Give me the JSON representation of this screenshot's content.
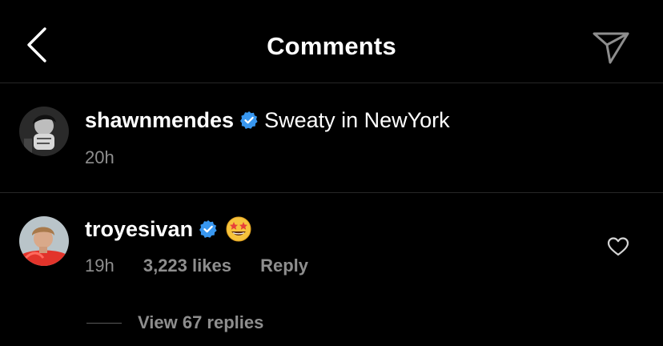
{
  "header": {
    "back_icon": "chevron-left-icon",
    "title": "Comments",
    "share_icon": "paper-plane-icon"
  },
  "caption": {
    "avatar_icon": "avatar-shawnmendes",
    "username": "shawnmendes",
    "verified_icon": "verified-badge-icon",
    "text": "Sweaty in NewYork",
    "time": "20h"
  },
  "comment": {
    "avatar_icon": "avatar-troyesivan",
    "username": "troyesivan",
    "verified_icon": "verified-badge-icon",
    "emoji": "star-struck-emoji",
    "time": "19h",
    "likes": "3,223 likes",
    "reply_label": "Reply",
    "heart_icon": "heart-outline-icon",
    "view_replies": "View 67 replies"
  },
  "colors": {
    "background": "#000000",
    "text": "#ffffff",
    "secondary_text": "#8e8e8e",
    "divider": "#262626",
    "verified_blue": "#3897f0"
  }
}
